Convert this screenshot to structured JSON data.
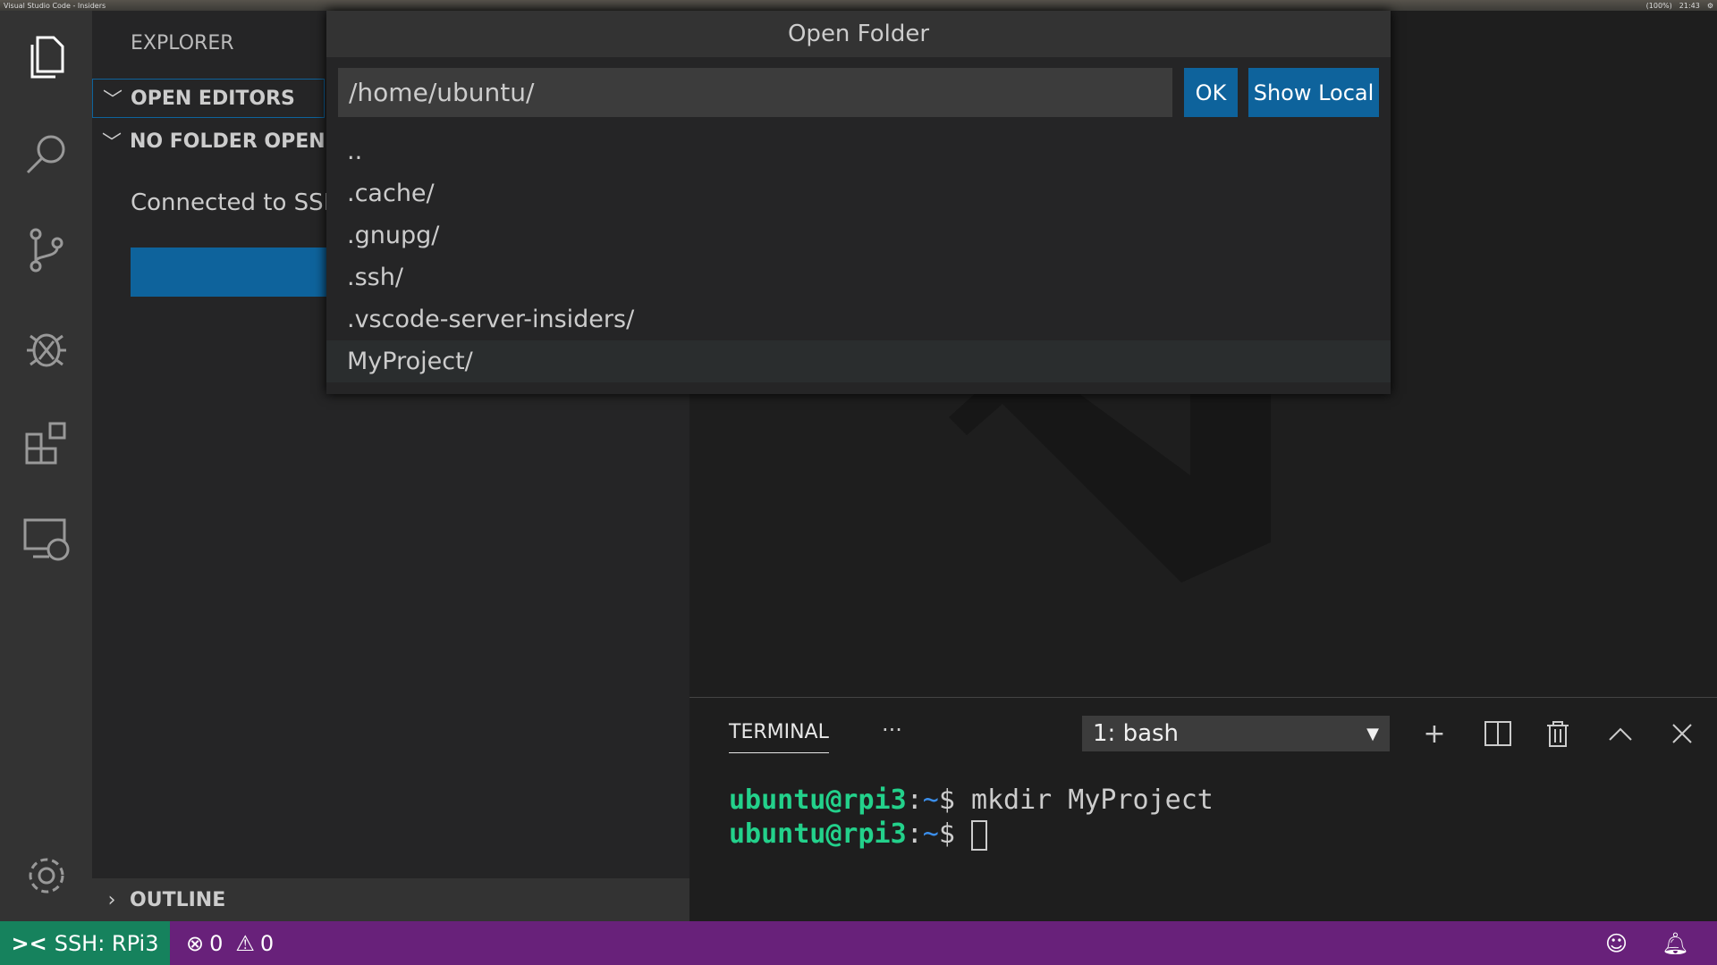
{
  "topbar": {
    "app_title": "Visual Studio Code - Insiders",
    "battery": "(100%)",
    "time": "21:43"
  },
  "activity_bar": {
    "items": [
      "explorer",
      "search",
      "source-control",
      "debug",
      "extensions",
      "remote-explorer"
    ],
    "settings": "gear"
  },
  "sidebar": {
    "title": "EXPLORER",
    "sections": [
      "OPEN EDITORS",
      "NO FOLDER OPENED"
    ],
    "message": "Connected to SSH",
    "outline": "OUTLINE"
  },
  "dialog": {
    "title": "Open Folder",
    "input_value": "/home/ubuntu/",
    "ok_label": "OK",
    "show_local_label": "Show Local",
    "items": [
      "..",
      ".cache/",
      ".gnupg/",
      ".ssh/",
      ".vscode-server-insiders/",
      "MyProject/"
    ],
    "selected_index": 5
  },
  "panel": {
    "tab": "TERMINAL",
    "more": "···",
    "terminal_select": "1: bash",
    "lines": [
      {
        "user": "ubuntu@rpi3",
        "path": "~",
        "command": "mkdir MyProject"
      },
      {
        "user": "ubuntu@rpi3",
        "path": "~",
        "command": ""
      }
    ]
  },
  "status": {
    "remote": "SSH: RPi3",
    "errors": "0",
    "warnings": "0"
  },
  "colors": {
    "accent": "#0e639c",
    "status_bar": "#68217a",
    "remote": "#16825d",
    "prompt_user": "#23d18b",
    "prompt_path": "#3b8eea"
  }
}
